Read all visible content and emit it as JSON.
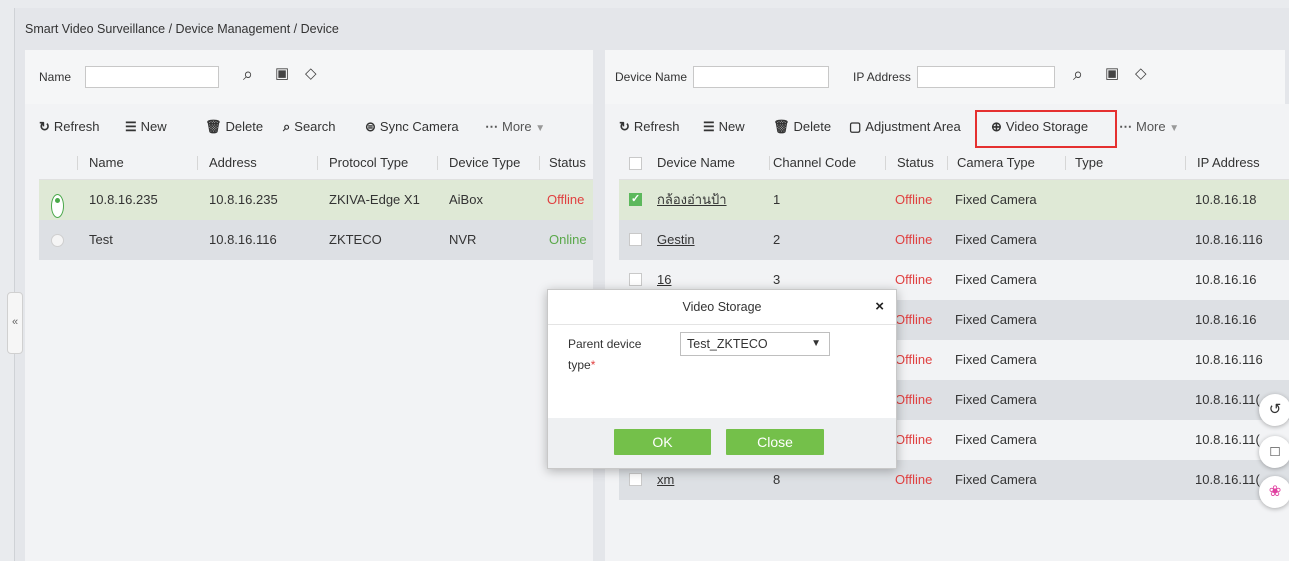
{
  "breadcrumb": "Smart Video Surveillance / Device Management / Device",
  "left": {
    "filter": {
      "name_label": "Name",
      "name_value": ""
    },
    "toolbar": {
      "refresh": "Refresh",
      "new": "New",
      "delete": "Delete",
      "search": "Search",
      "sync": "Sync Camera",
      "more": "More"
    },
    "columns": [
      "Name",
      "Address",
      "Protocol Type",
      "Device Type",
      "Status"
    ],
    "rows": [
      {
        "name": "10.8.16.235",
        "address": "10.8.16.235",
        "protocol": "ZKIVA-Edge X1",
        "type": "AiBox",
        "status": "Offline",
        "selected": true
      },
      {
        "name": "Test",
        "address": "10.8.16.116",
        "protocol": "ZKTECO",
        "type": "NVR",
        "status": "Online",
        "selected": false
      }
    ]
  },
  "right": {
    "filter": {
      "device_name_label": "Device Name",
      "device_name_value": "",
      "ip_label": "IP Address",
      "ip_value": ""
    },
    "toolbar": {
      "refresh": "Refresh",
      "new": "New",
      "delete": "Delete",
      "adjust": "Adjustment Area",
      "video_storage": "Video Storage",
      "more": "More"
    },
    "columns": [
      "Device Name",
      "Channel Code",
      "Status",
      "Camera Type",
      "Type",
      "IP Address"
    ],
    "rows": [
      {
        "name": "กล้องอ่านป้า",
        "channel": "1",
        "status": "Offline",
        "camera": "Fixed Camera",
        "type": "",
        "ip": "10.8.16.18",
        "checked": true
      },
      {
        "name": "Gestin",
        "channel": "2",
        "status": "Offline",
        "camera": "Fixed Camera",
        "type": "",
        "ip": "10.8.16.116",
        "checked": false
      },
      {
        "name": "16",
        "channel": "3",
        "status": "Offline",
        "camera": "Fixed Camera",
        "type": "",
        "ip": "10.8.16.16",
        "checked": false
      },
      {
        "name": "",
        "channel": "",
        "status": "Offline",
        "camera": "Fixed Camera",
        "type": "",
        "ip": "10.8.16.16",
        "checked": false
      },
      {
        "name": "",
        "channel": "",
        "status": "Offline",
        "camera": "Fixed Camera",
        "type": "",
        "ip": "10.8.16.116",
        "checked": false
      },
      {
        "name": "",
        "channel": "",
        "status": "Offline",
        "camera": "Fixed Camera",
        "type": "",
        "ip": "10.8.16.11(",
        "checked": false
      },
      {
        "name": "",
        "channel": "",
        "status": "Offline",
        "camera": "Fixed Camera",
        "type": "",
        "ip": "10.8.16.11(",
        "checked": false
      },
      {
        "name": "xm",
        "channel": "8",
        "status": "Offline",
        "camera": "Fixed Camera",
        "type": "",
        "ip": "10.8.16.11(",
        "checked": false
      }
    ]
  },
  "dialog": {
    "title": "Video Storage",
    "close_icon": "×",
    "field_label_1": "Parent device",
    "field_label_2": "type",
    "required_mark": "*",
    "select_value": "Test_ZKTECO",
    "ok": "OK",
    "close": "Close"
  },
  "colors": {
    "accent_green": "#74c04a",
    "status_offline": "#e04040",
    "status_online": "#5aa84a",
    "highlight_red": "#e53030"
  }
}
